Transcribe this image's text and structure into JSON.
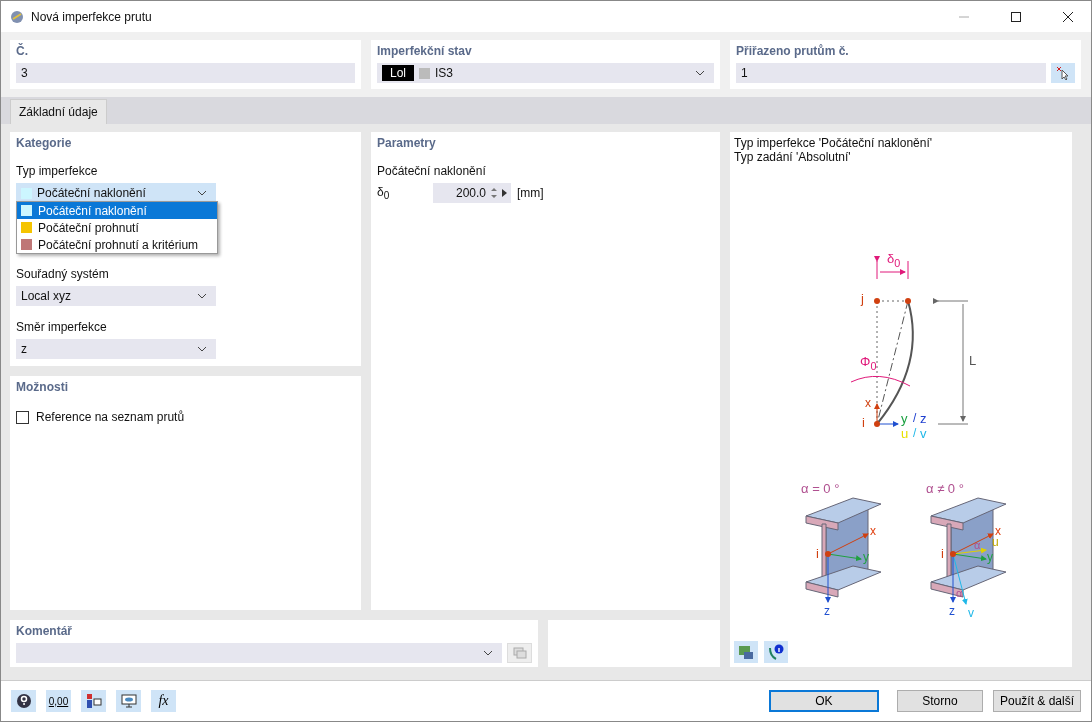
{
  "window": {
    "title": "Nová imperfekce prutu"
  },
  "header": {
    "number": {
      "label": "Č.",
      "value": "3"
    },
    "case": {
      "label": "Imperfekční stav",
      "badge": "Lol",
      "value": "IS3"
    },
    "members": {
      "label": "Přiřazeno prutům č.",
      "value": "1"
    }
  },
  "tabs": [
    {
      "label": "Základní údaje",
      "selected": true
    }
  ],
  "category": {
    "title": "Kategorie",
    "type_label": "Typ imperfekce",
    "type_value": "Počáteční naklonění",
    "options": [
      {
        "label": "Počáteční naklonění",
        "color": "#ccf6ff",
        "selected": true
      },
      {
        "label": "Počáteční prohnutí",
        "color": "#f5c400",
        "selected": false
      },
      {
        "label": "Počáteční prohnutí a kritérium",
        "color": "#bf7777",
        "selected": false
      }
    ],
    "coord_label": "Souřadný systém",
    "coord_value": "Local xyz",
    "dir_label": "Směr imperfekce",
    "dir_value": "z"
  },
  "options": {
    "title": "Možnosti",
    "checkbox": {
      "label": "Reference na seznam prutů",
      "checked": false
    }
  },
  "parameters": {
    "title": "Parametry",
    "group": "Počáteční naklonění",
    "symbol": "δ$_{0}$",
    "value": "200.0",
    "unit": "[mm]"
  },
  "info": {
    "lines": [
      "Typ imperfekce 'Počáteční naklonění'",
      "Typ zadání 'Absolutní'"
    ],
    "labels": [
      "δ$_{0}$",
      "j",
      "Φ$_{0}$",
      "L",
      "x",
      "i",
      "y",
      "/",
      "z",
      "u",
      "/",
      "v",
      "α = 0 °",
      "x",
      "i",
      "y",
      "z",
      "α ≠ 0 °",
      "x",
      "i",
      "u",
      "α",
      "y",
      "α",
      "z",
      "v"
    ]
  },
  "comment": {
    "title": "Komentář"
  },
  "footer": {
    "tools": [
      {
        "kind": "help"
      },
      {
        "kind": "decimals",
        "text": "0,00"
      },
      {
        "kind": "display"
      },
      {
        "kind": "view"
      },
      {
        "kind": "formula",
        "text": "fx"
      }
    ],
    "buttons": [
      {
        "label": "OK",
        "default": true
      },
      {
        "label": "Storno",
        "default": false
      },
      {
        "label": "Použít & další",
        "default": false
      }
    ]
  }
}
